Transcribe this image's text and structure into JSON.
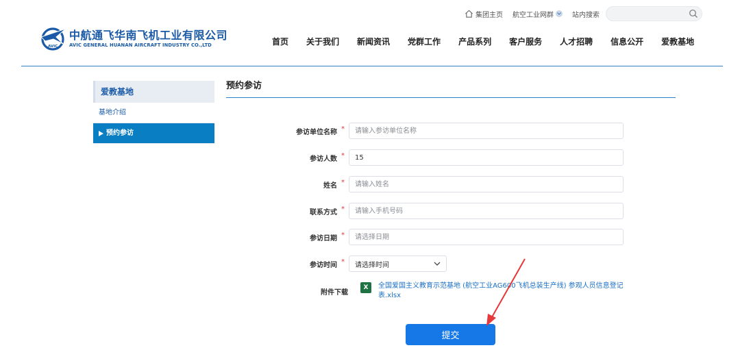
{
  "topbar": {
    "home_label": "集团主页",
    "network_label": "航空工业网群",
    "site_search_label": "站内搜索",
    "search_placeholder": ""
  },
  "logo": {
    "mark_text": "AVIC",
    "name_cn": "中航通飞华南飞机工业有限公司",
    "name_en": "AVIC GENERAL HUANAN AIRCRAFT INDUSTRY CO.,LTD"
  },
  "nav": {
    "items": [
      "首页",
      "关于我们",
      "新闻资讯",
      "党群工作",
      "产品系列",
      "客户服务",
      "人才招聘",
      "信息公开",
      "爱教基地"
    ]
  },
  "sidebar": {
    "title": "爱教基地",
    "items": [
      "基地介绍",
      "预约参访"
    ]
  },
  "content": {
    "title": "预约参访"
  },
  "form": {
    "unit_name": {
      "label": "参访单位名称",
      "placeholder": "请输入参访单位名称",
      "value": ""
    },
    "visitor_count": {
      "label": "参访人数",
      "placeholder": "",
      "value": "15"
    },
    "name": {
      "label": "姓名",
      "placeholder": "请输入姓名",
      "value": ""
    },
    "contact": {
      "label": "联系方式",
      "placeholder": "请输入手机号码",
      "value": ""
    },
    "visit_date": {
      "label": "参访日期",
      "placeholder": "请选择日期",
      "value": ""
    },
    "visit_time": {
      "label": "参访时间",
      "selected": "请选择时间"
    },
    "required_mark": "*",
    "attachment": {
      "label": "附件下载",
      "icon_text": "X",
      "link_text": "全国爱国主义教育示范基地 (航空工业AG600飞机总装生产线) 参观人员信息登记表.xlsx"
    },
    "submit_label": "提交"
  },
  "colors": {
    "brand_blue": "#1a5aa6",
    "nav_line": "#2f7fc1",
    "sidebar_active": "#0a7ec2",
    "submit_button": "#1677e6",
    "required_red": "#e0363b",
    "annotation_arrow": "#e5393b"
  }
}
